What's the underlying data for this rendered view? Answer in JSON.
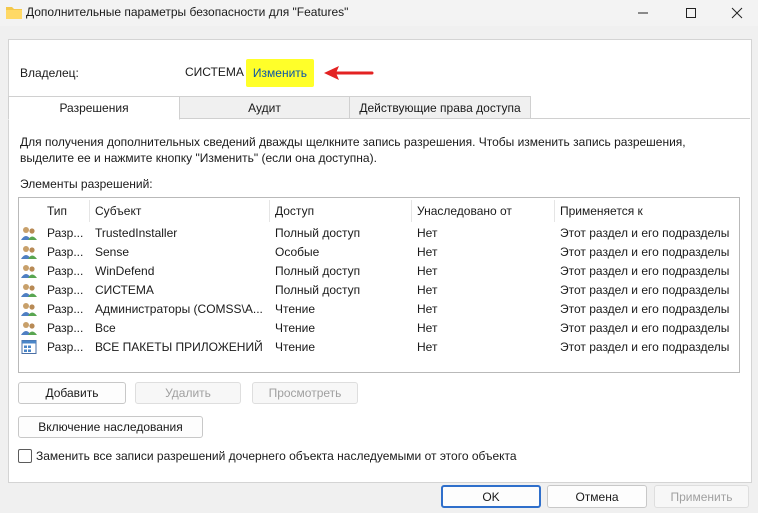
{
  "window": {
    "title": "Дополнительные параметры безопасности  для \"Features\""
  },
  "owner": {
    "label": "Владелец:",
    "value": "СИСТЕМА",
    "change_link": "Изменить"
  },
  "tabs": [
    {
      "label": "Разрешения",
      "active": true
    },
    {
      "label": "Аудит",
      "active": false
    },
    {
      "label": "Действующие права доступа",
      "active": false
    }
  ],
  "info_text": "Для получения дополнительных сведений дважды щелкните запись разрешения. Чтобы изменить запись разрешения, выделите ее и нажмите кнопку \"Изменить\" (если она доступна).",
  "elements_label": "Элементы разрешений:",
  "table": {
    "headers": [
      "Тип",
      "Субъект",
      "Доступ",
      "Унаследовано от",
      "Применяется к"
    ],
    "rows": [
      {
        "icon": "users-icon",
        "type": "Разр...",
        "subject": "TrustedInstaller",
        "access": "Полный доступ",
        "inherited": "Нет",
        "applies": "Этот раздел и его подразделы"
      },
      {
        "icon": "users-icon",
        "type": "Разр...",
        "subject": "Sense",
        "access": "Особые",
        "inherited": "Нет",
        "applies": "Этот раздел и его подразделы"
      },
      {
        "icon": "users-icon",
        "type": "Разр...",
        "subject": "WinDefend",
        "access": "Полный доступ",
        "inherited": "Нет",
        "applies": "Этот раздел и его подразделы"
      },
      {
        "icon": "users-icon",
        "type": "Разр...",
        "subject": "СИСТЕМА",
        "access": "Полный доступ",
        "inherited": "Нет",
        "applies": "Этот раздел и его подразделы"
      },
      {
        "icon": "users-icon",
        "type": "Разр...",
        "subject": "Администраторы (COMSS\\А...",
        "access": "Чтение",
        "inherited": "Нет",
        "applies": "Этот раздел и его подразделы"
      },
      {
        "icon": "users-icon",
        "type": "Разр...",
        "subject": "Все",
        "access": "Чтение",
        "inherited": "Нет",
        "applies": "Этот раздел и его подразделы"
      },
      {
        "icon": "app-packages-icon",
        "type": "Разр...",
        "subject": "ВСЕ ПАКЕТЫ ПРИЛОЖЕНИЙ",
        "access": "Чтение",
        "inherited": "Нет",
        "applies": "Этот раздел и его подразделы"
      }
    ]
  },
  "buttons": {
    "add": "Добавить",
    "remove": "Удалить",
    "view": "Просмотреть",
    "enable_inheritance": "Включение наследования",
    "ok": "OK",
    "cancel": "Отмена",
    "apply": "Применить"
  },
  "replace_checkbox": {
    "label": "Заменить все записи разрешений дочернего объекта наследуемыми от этого объекта",
    "checked": false
  },
  "colors": {
    "highlight": "#ffff29",
    "link": "#0a54a8",
    "arrow": "#e32222",
    "ok_border": "#2f6fcb"
  }
}
